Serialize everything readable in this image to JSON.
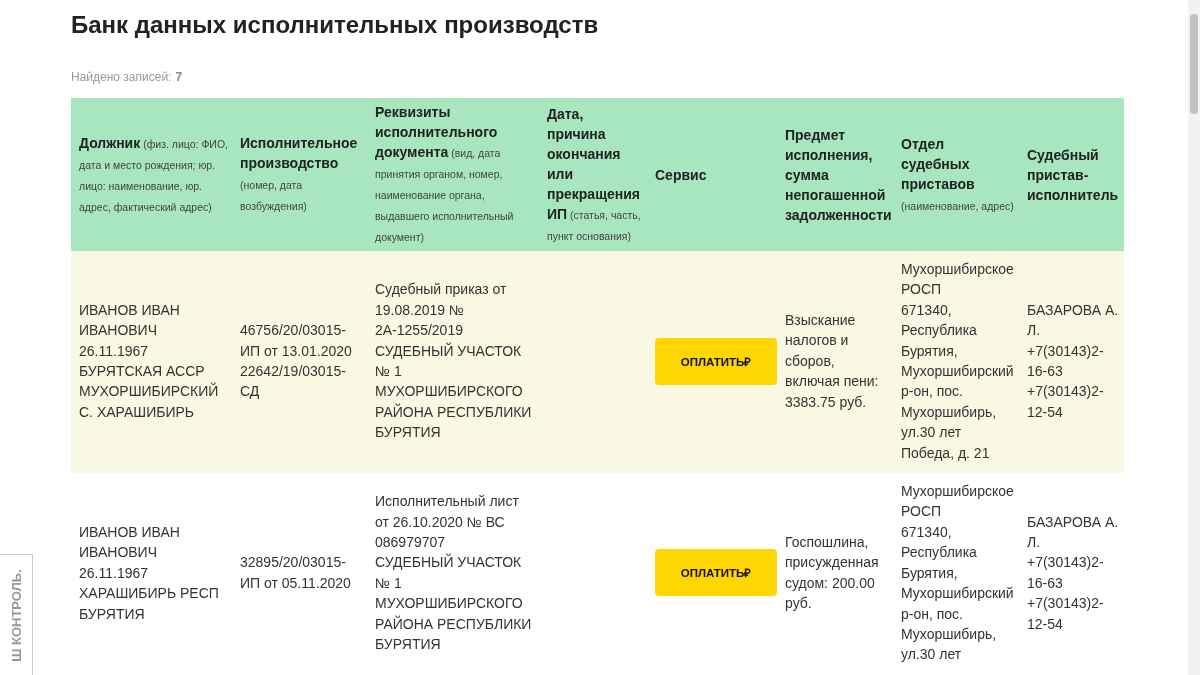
{
  "title": "Банк данных исполнительных производств",
  "found": {
    "label": "Найдено записей:",
    "count": "7"
  },
  "table": {
    "columns": [
      {
        "title": "Должник",
        "note": "(физ. лицо: ФИО, дата и место рождения; юр. лицо: наименование, юр. адрес, фактический адрес)"
      },
      {
        "title": "Исполнительное производство",
        "note": "(номер, дата возбуждения)"
      },
      {
        "title": "Реквизиты исполнительного документа",
        "note": "(вид, дата принятия органом, номер, наименование органа, выдавшего исполнительный документ)"
      },
      {
        "title": "Дата, причина окончания или прекращения ИП",
        "note": "(статья, часть, пункт основания)"
      },
      {
        "title": "Сервис"
      },
      {
        "title": "Предмет исполнения, сумма непогашенной задолженности"
      },
      {
        "title": "Отдел судебных приставов",
        "note": "(наименование, адрес)"
      },
      {
        "title": "Судебный пристав-исполнитель"
      }
    ],
    "rows": [
      {
        "debtor": [
          "ИВАНОВ ИВАН ИВАНОВИЧ",
          "26.11.1967",
          "БУРЯТСКАЯ АССР МУХОРШИБИРСКИЙ С. ХАРАШИБИРЬ"
        ],
        "production": [
          "46756/20/03015-ИП от 13.01.2020",
          "22642/19/03015-СД"
        ],
        "document": [
          "Судебный приказ от 19.08.2019 № 2А-1255/2019",
          "СУДЕБНЫЙ УЧАСТОК № 1 МУХОРШИБИРСКОГО РАЙОНА РЕСПУБЛИКИ БУРЯТИЯ"
        ],
        "service": "ОПЛАТИТЬ₽",
        "subject": [
          "Взыскание налогов и сборов, включая пени: 3383.75 руб."
        ],
        "department": [
          "Мухоршибирское РОСП",
          "671340, Республика Бурятия, Мухоршибирский р-он, пос. Мухоршибирь, ул.30 лет Победа, д. 21"
        ],
        "bailiff": [
          "БАЗАРОВА А. Л.",
          "+7(30143)2-16-63",
          "+7(30143)2-12-54"
        ]
      },
      {
        "debtor": [
          "ИВАНОВ ИВАН ИВАНОВИЧ",
          "26.11.1967",
          "ХАРАШИБИРЬ РЕСП БУРЯТИЯ"
        ],
        "production": [
          "32895/20/03015-ИП от 05.11.2020"
        ],
        "document": [
          "Исполнительный лист от 26.10.2020 № ВС 086979707",
          "СУДЕБНЫЙ УЧАСТОК № 1 МУХОРШИБИРСКОГО РАЙОНА РЕСПУБЛИКИ БУРЯТИЯ"
        ],
        "service": "ОПЛАТИТЬ₽",
        "subject": [
          "Госпошлина, присужденная судом: 200.00 руб."
        ],
        "department": [
          "Мухоршибирское РОСП",
          "671340, Республика Бурятия, Мухоршибирский р-он, пос. Мухоршибирь, ул.30 лет"
        ],
        "bailiff": [
          "БАЗАРОВА А. Л.",
          "+7(30143)2-16-63",
          "+7(30143)2-12-54"
        ]
      }
    ]
  },
  "side_tab": {
    "label": "Ш КОНТРОЛЬ."
  }
}
